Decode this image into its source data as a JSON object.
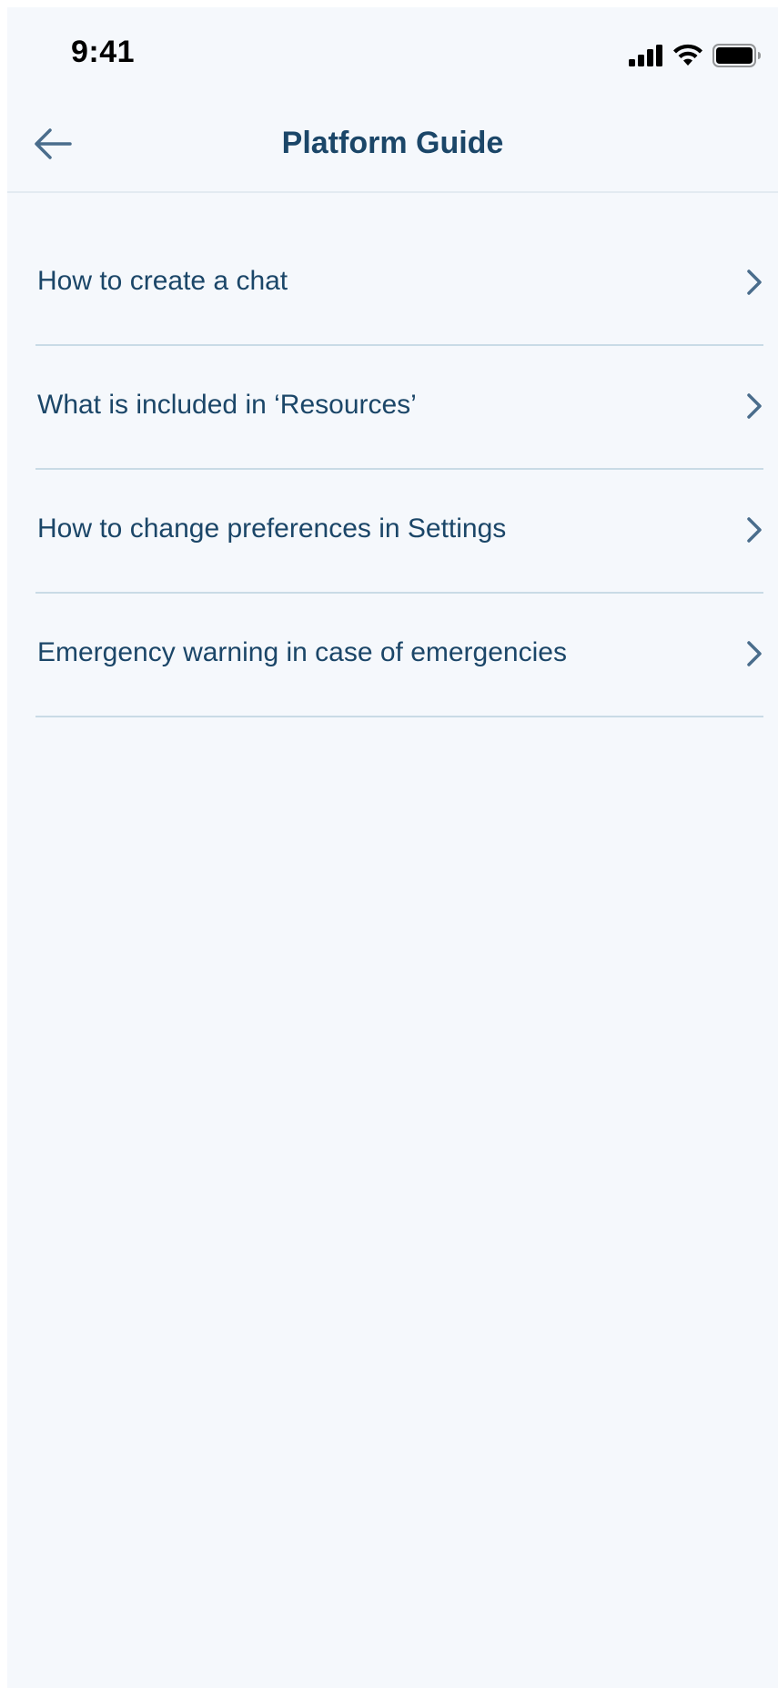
{
  "status_bar": {
    "time": "9:41",
    "icons": [
      "cellular-signal-icon",
      "wifi-icon",
      "battery-icon"
    ]
  },
  "nav": {
    "title": "Platform Guide",
    "back_icon": "arrow-left-icon"
  },
  "guide": {
    "items": [
      {
        "label": "How to create a chat"
      },
      {
        "label": "What is included in ‘Resources’"
      },
      {
        "label": "How to change preferences in Settings"
      },
      {
        "label": "Emergency warning in case of emergencies"
      }
    ],
    "chevron_icon": "chevron-right-icon"
  },
  "colors": {
    "background": "#f5f8fc",
    "text": "#1b4668",
    "icon": "#4a6d8c",
    "divider": "#c9dbe6"
  }
}
